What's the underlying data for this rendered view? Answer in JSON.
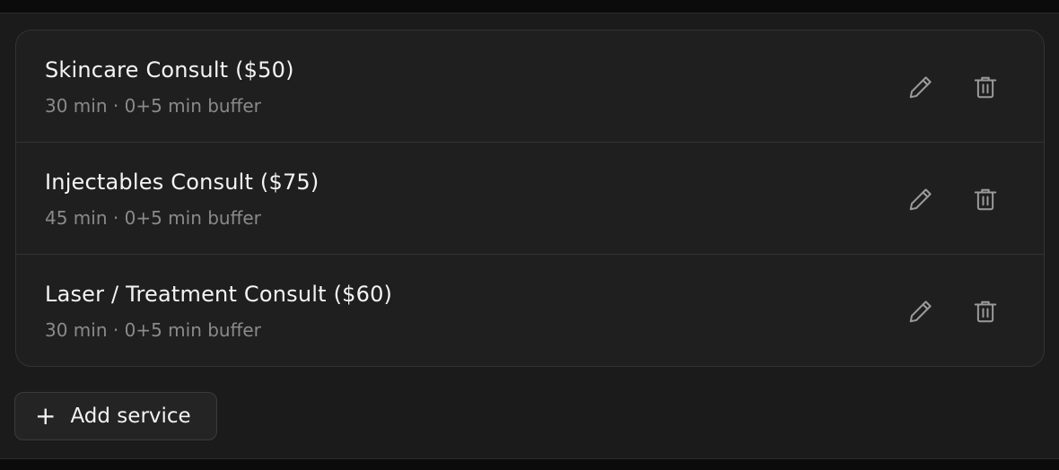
{
  "services": [
    {
      "title": "Skincare Consult ($50)",
      "meta": "30 min · 0+5 min buffer"
    },
    {
      "title": "Injectables Consult ($75)",
      "meta": "45 min · 0+5 min buffer"
    },
    {
      "title": "Laser / Treatment Consult ($60)",
      "meta": "30 min · 0+5 min buffer"
    }
  ],
  "add_button": {
    "icon": "plus-icon",
    "label": "Add service"
  },
  "icons": {
    "edit": "pencil-icon",
    "delete": "trash-icon"
  },
  "colors": {
    "background": "#1b1b1b",
    "text": "#f2f2f2",
    "muted": "#8a8a8a",
    "border": "#333333"
  }
}
